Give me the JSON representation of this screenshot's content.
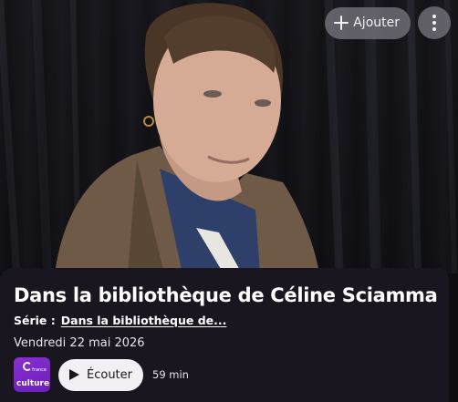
{
  "top_actions": {
    "add_label": "Ajouter",
    "add_icon": "plus-icon",
    "more_icon": "more-vertical-icon"
  },
  "episode": {
    "title": "Dans la bibliothèque de Céline Sciamma",
    "series_label": "Série :",
    "series_name": "Dans la bibliothèque de...",
    "date": "Vendredi 22 mai 2026"
  },
  "station": {
    "logo_top": "france",
    "logo_bottom": "culture",
    "color": "#7a28c6"
  },
  "player": {
    "play_label": "Écouter",
    "play_icon": "play-icon",
    "duration": "59 min"
  }
}
